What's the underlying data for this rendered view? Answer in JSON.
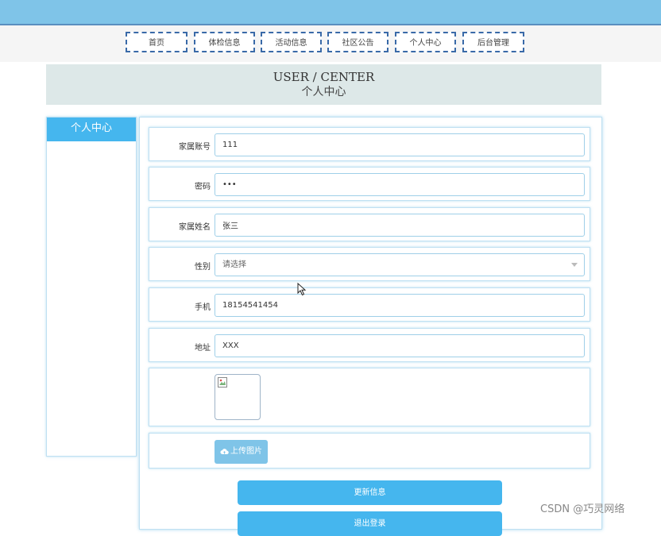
{
  "nav": {
    "items": [
      {
        "label": "首页"
      },
      {
        "label": "体检信息"
      },
      {
        "label": "活动信息"
      },
      {
        "label": "社区公告"
      },
      {
        "label": "个人中心"
      },
      {
        "label": "后台管理"
      }
    ]
  },
  "banner": {
    "title_en": "USER / CENTER",
    "title_cn": "个人中心"
  },
  "sidebar": {
    "title": "个人中心"
  },
  "form": {
    "account": {
      "label": "家属账号",
      "value": "111"
    },
    "password": {
      "label": "密码",
      "value": "•••"
    },
    "name": {
      "label": "家属姓名",
      "value": "张三"
    },
    "gender": {
      "label": "性别",
      "value": "请选择"
    },
    "phone": {
      "label": "手机",
      "value": "18154541454"
    },
    "address": {
      "label": "地址",
      "value": "XXX"
    },
    "upload_label": "上传图片"
  },
  "buttons": {
    "update": "更新信息",
    "logout": "退出登录"
  },
  "watermark": "CSDN @巧灵网络",
  "colors": {
    "accent": "#45b6ee",
    "topbar": "#7fc4e8",
    "nav_border": "#3a6aa8"
  }
}
